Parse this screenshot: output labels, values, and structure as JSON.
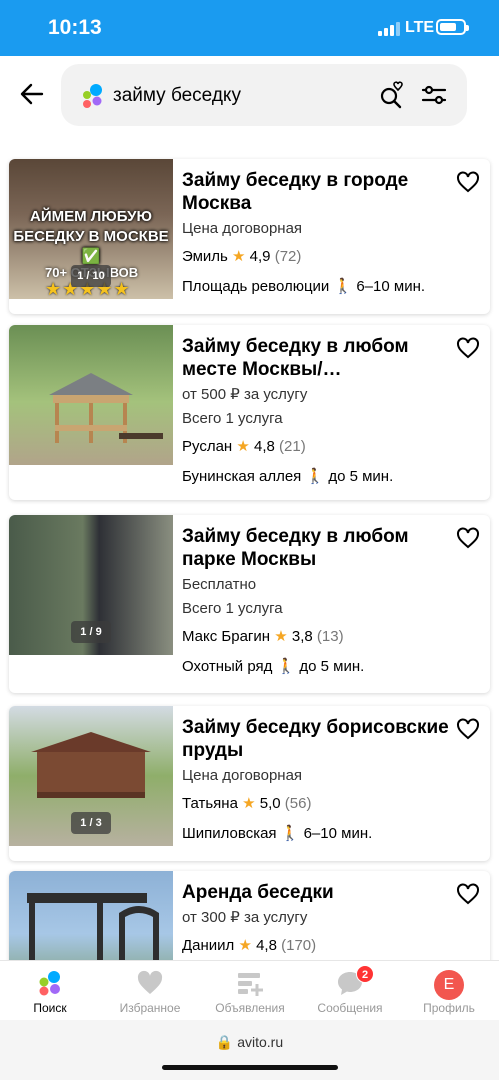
{
  "status_bar": {
    "time": "10:13",
    "network": "LTE"
  },
  "search": {
    "query": "займу беседку"
  },
  "listings": [
    {
      "title": "Займу беседку в городе Москва",
      "price": "Цена договорная",
      "services": "",
      "seller": "Эмиль",
      "rating": "4,9",
      "reviews": "(72)",
      "metro": "Площадь революции",
      "walk": "6–10 мин.",
      "photo_counter": "1 / 10",
      "photo_text": "АЙМЕМ ЛЮБУЮ БЕСЕДКУ В МОСКВЕ ✅",
      "photo_badge": "70+ ОТЗЫВОВ",
      "photo_stars": "★★★★★"
    },
    {
      "title": "Займу беседку в любом месте Москвы/…",
      "price": "от 500 ₽ за услугу",
      "services": "Всего 1 услуга",
      "seller": "Руслан",
      "rating": "4,8",
      "reviews": "(21)",
      "metro": "Бунинская аллея",
      "walk": "до 5 мин.",
      "photo_counter": ""
    },
    {
      "title": "Займу беседку в любом парке Москвы",
      "price": "Бесплатно",
      "services": "Всего 1 услуга",
      "seller": "Макс Брагин",
      "rating": "3,8",
      "reviews": "(13)",
      "metro": "Охотный ряд",
      "walk": "до 5 мин.",
      "photo_counter": "1 / 9"
    },
    {
      "title": "Займу беседку борисовские пруды",
      "price": "Цена договорная",
      "services": "",
      "seller": "Татьяна",
      "rating": "5,0",
      "reviews": "(56)",
      "metro": "Шипиловская",
      "walk": "6–10 мин.",
      "photo_counter": "1 / 3"
    },
    {
      "title": "Аренда беседки",
      "price": "от 300 ₽ за услугу",
      "services": "",
      "seller": "Даниил",
      "rating": "4,8",
      "reviews": "(170)",
      "metro": "",
      "walk": "",
      "photo_counter": ""
    }
  ],
  "tabbar": {
    "tabs": [
      {
        "label": "Поиск",
        "icon": "avito-logo-icon"
      },
      {
        "label": "Избранное",
        "icon": "heart-icon"
      },
      {
        "label": "Объявления",
        "icon": "add-listing-icon"
      },
      {
        "label": "Сообщения",
        "icon": "chat-icon",
        "badge": "2"
      },
      {
        "label": "Профиль",
        "icon": "avatar",
        "avatar_letter": "E"
      }
    ]
  },
  "browser": {
    "url": "avito.ru"
  },
  "colors": {
    "status_bar": "#1a9bf0",
    "star": "#f5a623",
    "badge": "#ff3333",
    "avatar": "#f2564f"
  }
}
